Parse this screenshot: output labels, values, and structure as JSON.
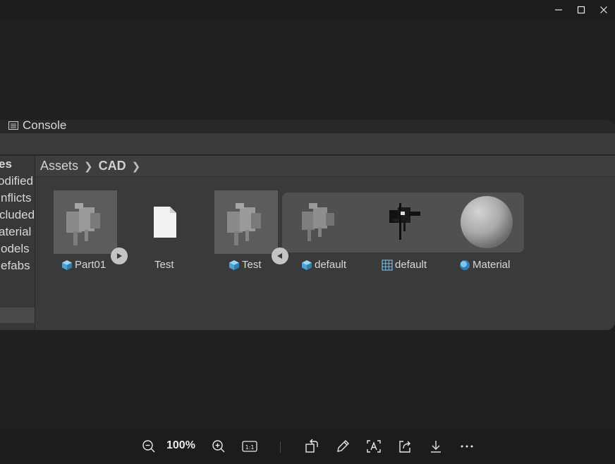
{
  "window": {
    "controls": [
      "minimize-icon",
      "maximize-icon",
      "close-icon"
    ]
  },
  "screenshot": {
    "console_tab": "Console",
    "left_panel": {
      "items": [
        "es",
        "odified",
        "nflicts",
        "cluded",
        "aterial",
        "odels",
        "efabs"
      ]
    },
    "breadcrumb": {
      "root": "Assets",
      "current": "CAD"
    },
    "assets": [
      {
        "label": "Part01",
        "icon": "prefab-icon"
      },
      {
        "label": "Test",
        "icon": "file-icon"
      },
      {
        "label": "Test",
        "icon": "prefab-icon"
      },
      {
        "label": "default",
        "icon": "prefab-icon"
      },
      {
        "label": "default",
        "icon": "mesh-icon"
      },
      {
        "label": "Material",
        "icon": "material-icon"
      }
    ]
  },
  "toolbar": {
    "zoom": "100%",
    "tools": [
      "zoom-out-icon",
      "zoom-in-icon",
      "actual-size-icon",
      "rotate-icon",
      "edit-icon",
      "text-recognition-icon",
      "share-icon",
      "download-icon",
      "more-icon"
    ]
  },
  "colors": {
    "background": "#202020",
    "panel": "#3a3a3a",
    "accent": "#4aa3d8"
  }
}
